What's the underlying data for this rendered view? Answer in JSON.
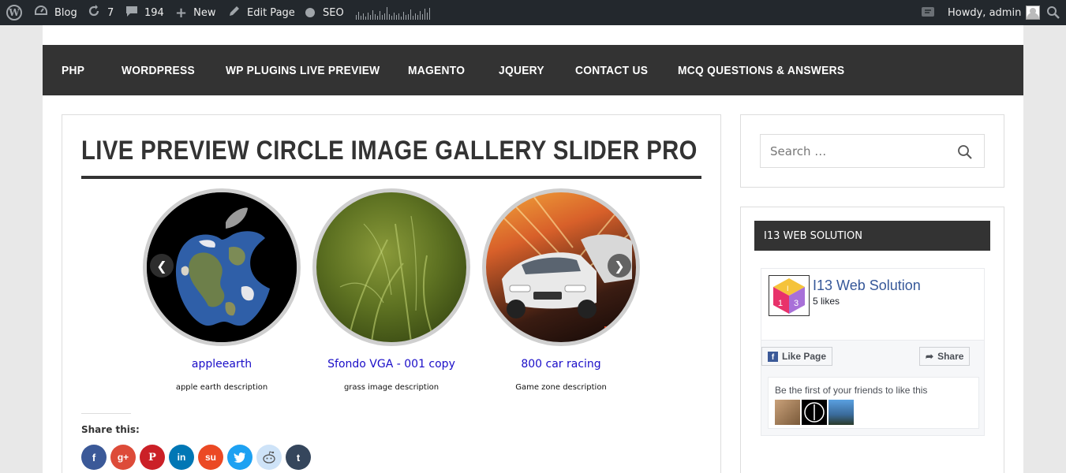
{
  "adminbar": {
    "site_label": "Blog",
    "updates_count": "7",
    "comments_count": "194",
    "new_label": "New",
    "edit_label": "Edit Page",
    "seo_label": "SEO",
    "greeting": "Howdy, admin"
  },
  "nav": {
    "items": [
      "PHP",
      "WORDPRESS",
      "WP PLUGINS LIVE PREVIEW",
      "MAGENTO",
      "JQUERY",
      "CONTACT US",
      "MCQ QUESTIONS & ANSWERS"
    ]
  },
  "post": {
    "title": "LIVE PREVIEW CIRCLE IMAGE GALLERY SLIDER PRO",
    "slides": [
      {
        "title": "appleearth",
        "description": "apple earth description"
      },
      {
        "title": "Sfondo VGA - 001 copy",
        "description": "grass image description"
      },
      {
        "title": "800 car racing",
        "description": "Game zone description"
      }
    ],
    "share_title": "Share this:"
  },
  "sidebar": {
    "search_placeholder": "Search …",
    "widget_title": "I13 WEB SOLUTION",
    "fb": {
      "page_name": "I13 Web Solution",
      "likes": "5 likes",
      "like_button": "Like Page",
      "share_button": "Share",
      "friends_text": "Be the first of your friends to like this"
    }
  },
  "colors": {
    "admin_bar": "#23282d",
    "nav_bg": "#333333",
    "link": "#1a0dc8",
    "facebook": "#3b5998",
    "google_plus": "#dd4b39",
    "pinterest": "#cb2027",
    "linkedin": "#0077b5",
    "stumbleupon": "#eb4924",
    "twitter": "#1da1f2",
    "reddit": "#cee3f8",
    "tumblr": "#35465c"
  }
}
